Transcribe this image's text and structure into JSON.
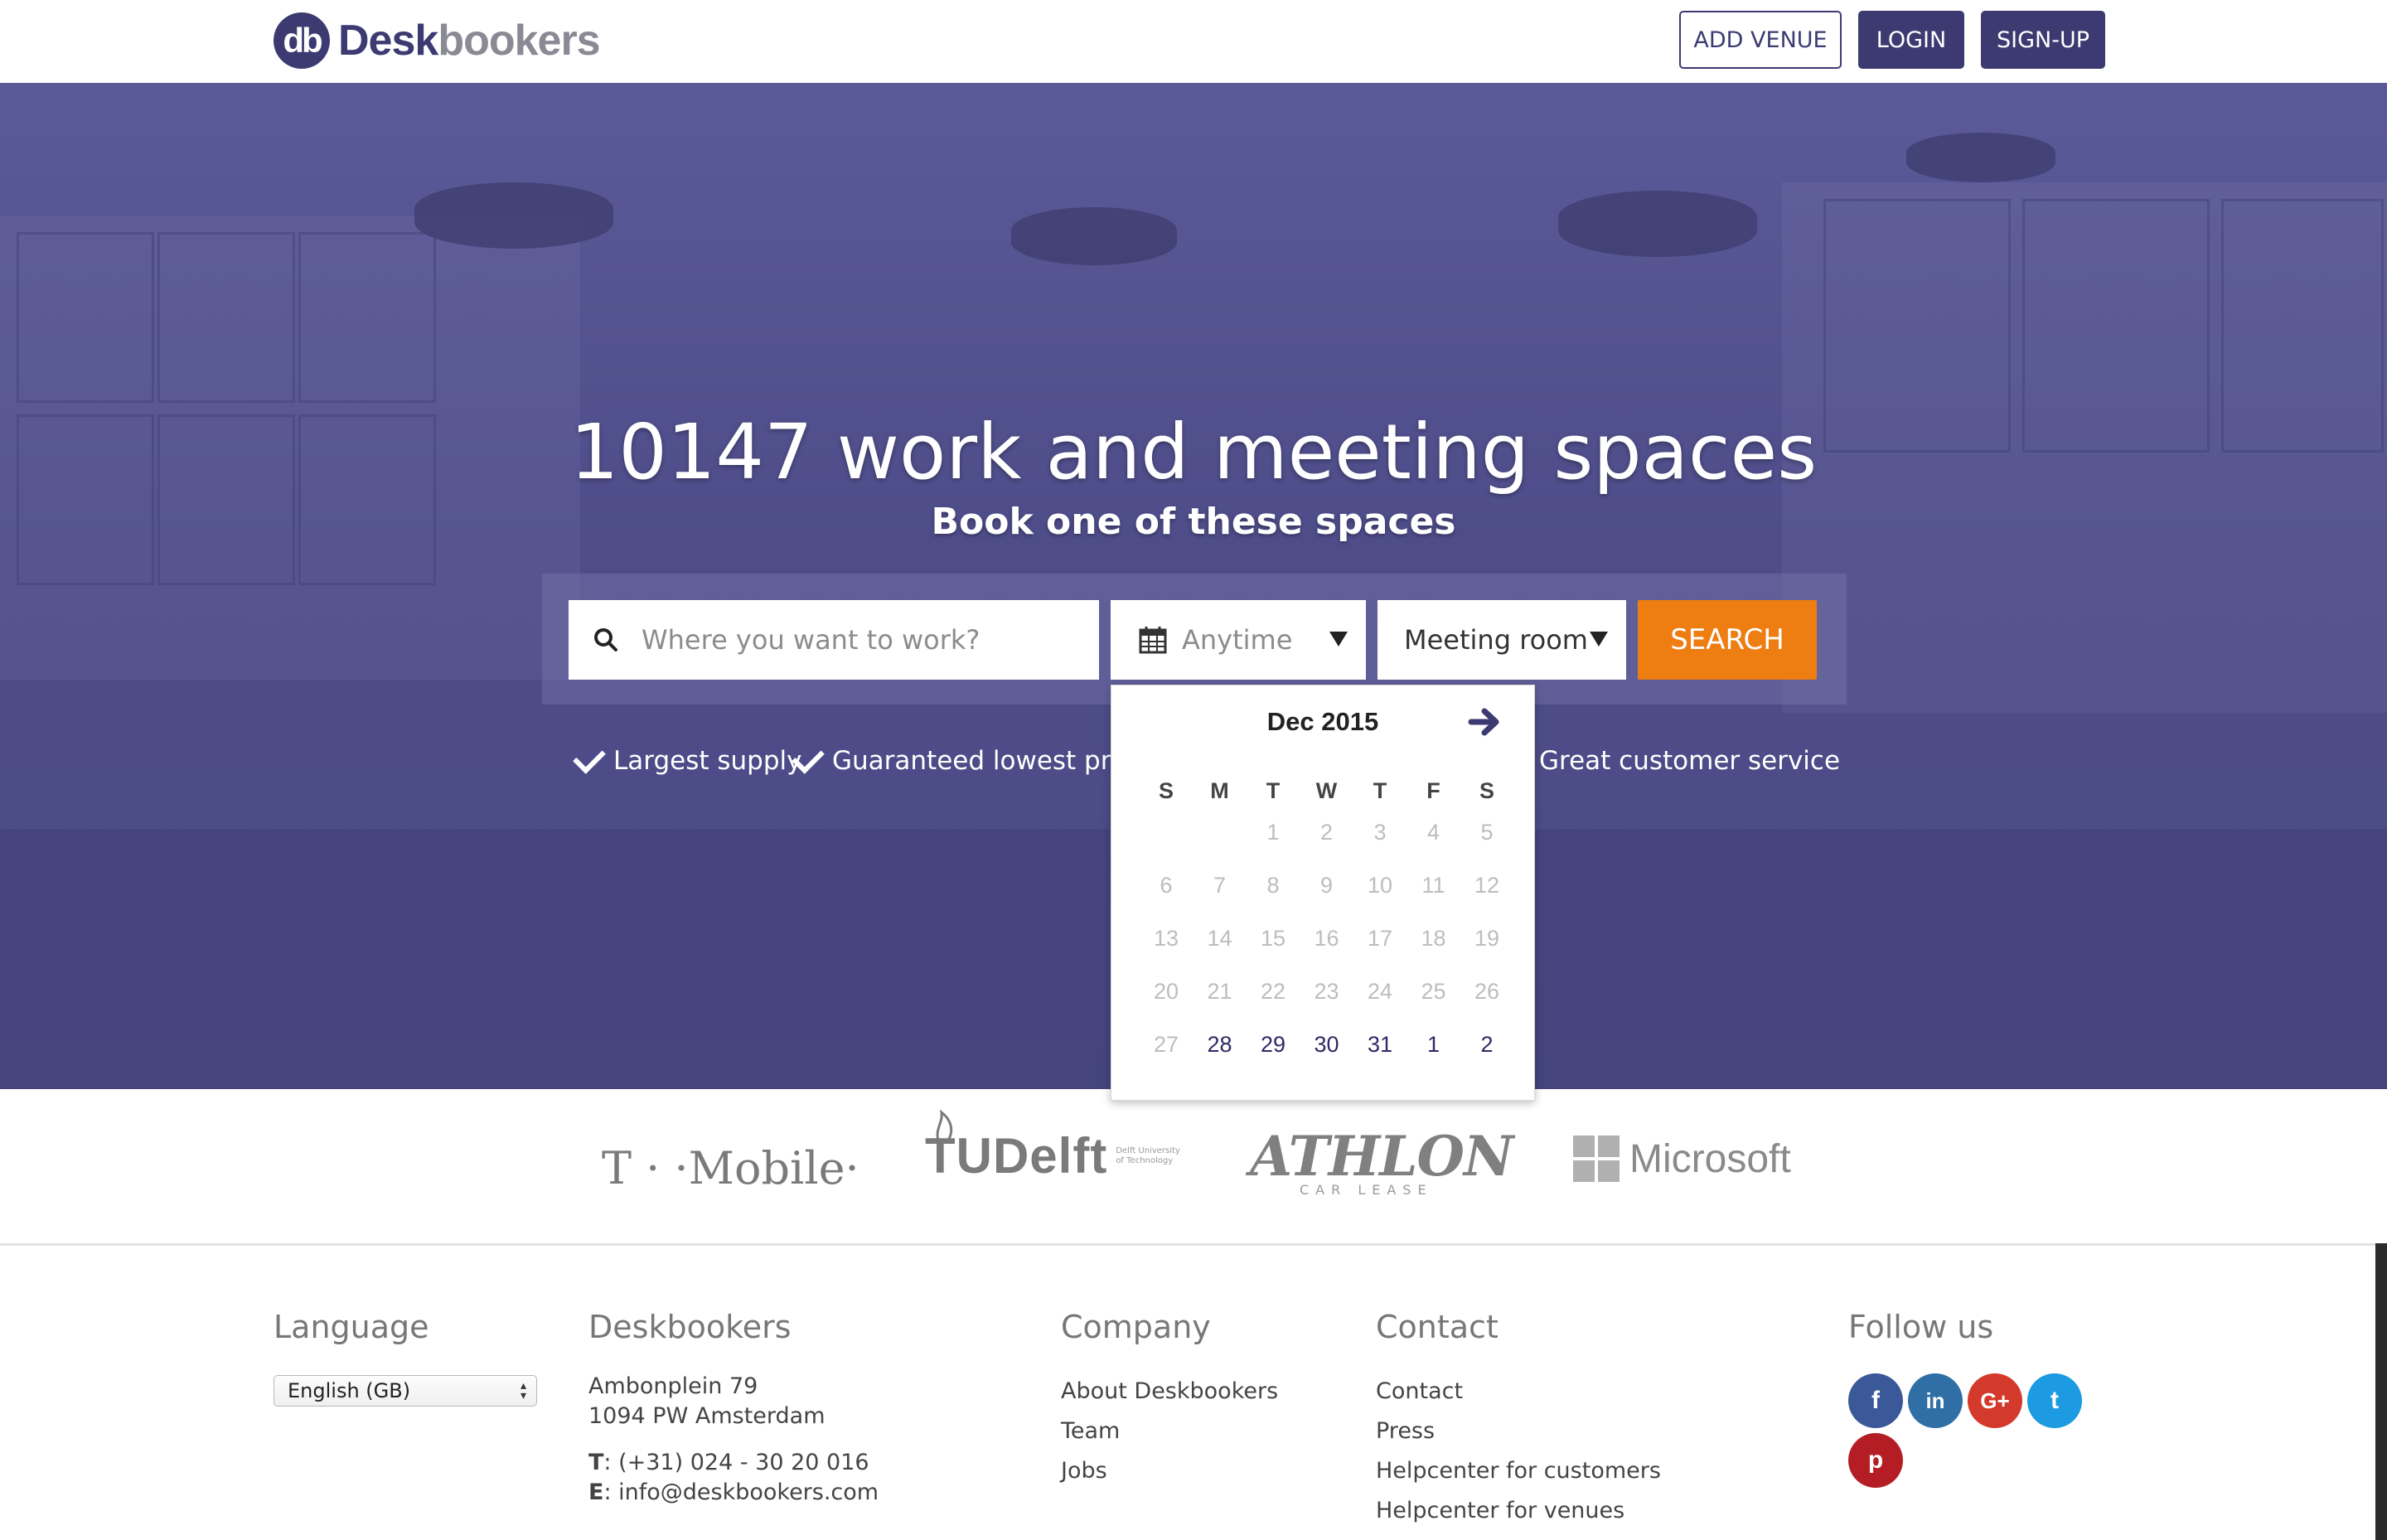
{
  "header": {
    "logo_badge": "db",
    "logo_part1": "Desk",
    "logo_part2": "bookers",
    "add_venue": "ADD VENUE",
    "login": "LOGIN",
    "signup": "SIGN-UP"
  },
  "hero": {
    "title": "10147 work and meeting spaces",
    "subtitle": "Book one of these spaces",
    "search": {
      "where_placeholder": "Where you want to work?",
      "date_placeholder": "Anytime",
      "type_value": "Meeting room",
      "button": "SEARCH"
    },
    "usps": [
      "Largest supply",
      "Guaranteed lowest price",
      "Great customer service"
    ]
  },
  "calendar": {
    "month_label": "Dec 2015",
    "weekdays": [
      "S",
      "M",
      "T",
      "W",
      "T",
      "F",
      "S"
    ],
    "weeks": [
      [
        {
          "d": ""
        },
        {
          "d": ""
        },
        {
          "d": "1",
          "s": "past"
        },
        {
          "d": "2",
          "s": "past"
        },
        {
          "d": "3",
          "s": "past"
        },
        {
          "d": "4",
          "s": "past"
        },
        {
          "d": "5",
          "s": "past"
        }
      ],
      [
        {
          "d": "6",
          "s": "past"
        },
        {
          "d": "7",
          "s": "past"
        },
        {
          "d": "8",
          "s": "past"
        },
        {
          "d": "9",
          "s": "past"
        },
        {
          "d": "10",
          "s": "past"
        },
        {
          "d": "11",
          "s": "past"
        },
        {
          "d": "12",
          "s": "past"
        }
      ],
      [
        {
          "d": "13",
          "s": "past"
        },
        {
          "d": "14",
          "s": "past"
        },
        {
          "d": "15",
          "s": "past"
        },
        {
          "d": "16",
          "s": "past"
        },
        {
          "d": "17",
          "s": "past"
        },
        {
          "d": "18",
          "s": "past"
        },
        {
          "d": "19",
          "s": "past"
        }
      ],
      [
        {
          "d": "20",
          "s": "past"
        },
        {
          "d": "21",
          "s": "past"
        },
        {
          "d": "22",
          "s": "past"
        },
        {
          "d": "23",
          "s": "past"
        },
        {
          "d": "24",
          "s": "past"
        },
        {
          "d": "25",
          "s": "past"
        },
        {
          "d": "26",
          "s": "past"
        }
      ],
      [
        {
          "d": "27",
          "s": "past"
        },
        {
          "d": "28",
          "s": "avail"
        },
        {
          "d": "29",
          "s": "avail"
        },
        {
          "d": "30",
          "s": "avail"
        },
        {
          "d": "31",
          "s": "avail"
        },
        {
          "d": "1",
          "s": "avail"
        },
        {
          "d": "2",
          "s": "avail"
        }
      ]
    ]
  },
  "logos": {
    "tmobile": "T · ·Mobile·",
    "tudelft": "TUDelft",
    "tudelft_small": "Delft University of Technology",
    "athlon": "ATHLON",
    "athlon_small": "CAR LEASE",
    "microsoft": "Microsoft"
  },
  "footer": {
    "language_title": "Language",
    "language_value": "English (GB)",
    "deskbookers_title": "Deskbookers",
    "address_line1": "Ambonplein 79",
    "address_line2": "1094 PW Amsterdam",
    "phone_label": "T",
    "phone": ": (+31) 024 - 30 20 016",
    "email_label": "E",
    "email": ": info@deskbookers.com",
    "company_title": "Company",
    "company_links": [
      "About Deskbookers",
      "Team",
      "Jobs"
    ],
    "contact_title": "Contact",
    "contact_links": [
      "Contact",
      "Press",
      "Helpcenter for customers",
      "Helpcenter for venues"
    ],
    "follow_title": "Follow us",
    "social": [
      {
        "name": "facebook",
        "glyph": "f",
        "color": "#3b5998"
      },
      {
        "name": "linkedin",
        "glyph": "in",
        "color": "#2f6fa6"
      },
      {
        "name": "google-plus",
        "glyph": "G+",
        "color": "#d33a2c"
      },
      {
        "name": "twitter",
        "glyph": "t",
        "color": "#1c9be2"
      },
      {
        "name": "pinterest",
        "glyph": "p",
        "color": "#b51d24"
      }
    ]
  },
  "colors": {
    "brand": "#3d3a72",
    "search_button": "#ee7d12",
    "hero_overlay": "#4e4d8a"
  }
}
